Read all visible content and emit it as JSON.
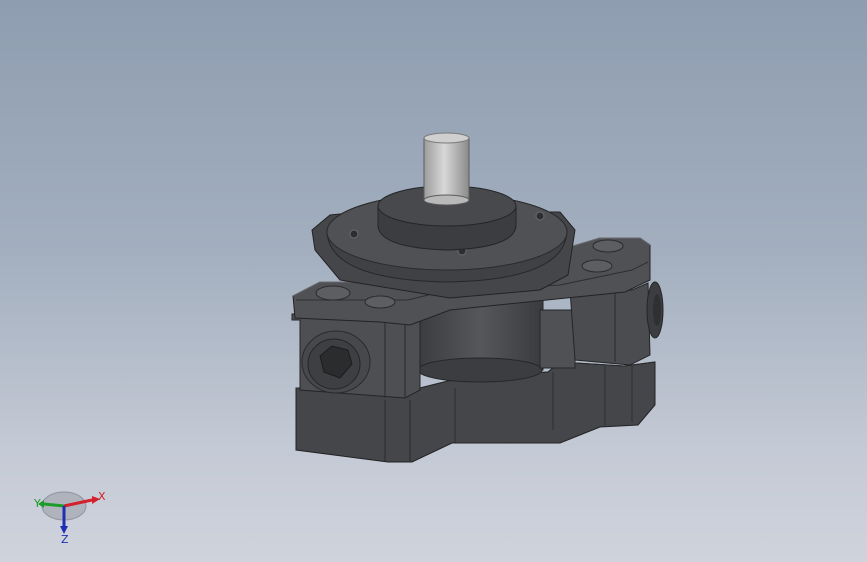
{
  "viewport": {
    "background_top": "#8e9db0",
    "background_bottom": "#cfd3dc"
  },
  "model": {
    "body_color": "#4a4b4e",
    "shaft_color": "#c9c9c9"
  },
  "triad": {
    "x_label": "X",
    "y_label": "Y",
    "z_label": "Z",
    "x_color": "#d3202a",
    "y_color": "#1c9c2a",
    "z_color": "#1f2fb5"
  }
}
